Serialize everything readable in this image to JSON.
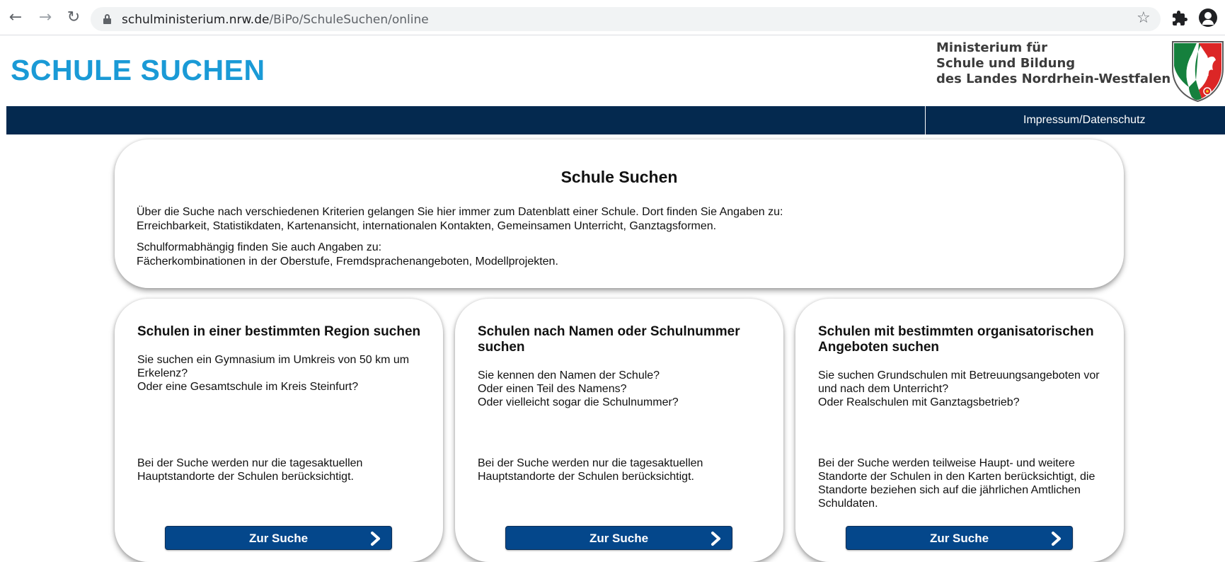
{
  "browser": {
    "url_domain": "schulministerium.nrw.de",
    "url_path": "/BiPo/SchuleSuchen/online",
    "icons": [
      "back-arrow-icon",
      "forward-arrow-icon",
      "reload-icon",
      "lock-icon",
      "star-icon",
      "extensions-icon",
      "profile-icon"
    ]
  },
  "header": {
    "site_title": "SCHULE SUCHEN",
    "ministry_line1": "Ministerium für",
    "ministry_line2": "Schule und Bildung",
    "ministry_line3": "des Landes Nordrhein-Westfalen",
    "logo_icon": "nrw-coat-of-arms-icon"
  },
  "navbar": {
    "link": "Impressum/Datenschutz"
  },
  "intro": {
    "title": "Schule Suchen",
    "p1_line1": "Über die Suche nach verschiedenen Kriterien gelangen Sie hier immer zum Datenblatt einer Schule. Dort finden Sie Angaben zu:",
    "p1_line2": "Erreichbarkeit, Statistikdaten, Kartenansicht, internationalen Kontakten, Gemeinsamen Unterricht, Ganztagsformen.",
    "p2_line1": "Schulformabhängig finden Sie auch Angaben zu:",
    "p2_line2": "Fächerkombinationen in der Oberstufe, Fremdsprachenangeboten, Modellprojekten."
  },
  "cards": [
    {
      "title": "Schulen in einer bestimmten Region suchen",
      "desc_line1": "Sie suchen ein Gymnasium im Umkreis von 50 km um",
      "desc_line2": "Erkelenz?",
      "desc_line3": "Oder eine Gesamtschule im Kreis Steinfurt?",
      "note_line1": "Bei der Suche werden nur die tagesaktuellen",
      "note_line2": "Hauptstandorte der Schulen berücksichtigt.",
      "button": "Zur Suche"
    },
    {
      "title": "Schulen nach Namen oder Schulnummer suchen",
      "desc_line1": "Sie kennen den Namen der Schule?",
      "desc_line2": "Oder einen Teil des Namens?",
      "desc_line3": "Oder vielleicht sogar die Schulnummer?",
      "note_line1": "Bei der Suche werden nur die tagesaktuellen",
      "note_line2": "Hauptstandorte der Schulen berücksichtigt.",
      "button": "Zur Suche"
    },
    {
      "title": "Schulen mit bestimmten organisatorischen Angeboten suchen",
      "desc_line1": "Sie suchen Grundschulen mit Betreuungsangeboten vor",
      "desc_line2": "und nach dem Unterricht?",
      "desc_line3": "Oder Realschulen mit Ganztagsbetrieb?",
      "note_line1": "Bei der Suche werden teilweise Haupt- und weitere",
      "note_line2": "Standorte der Schulen in den Karten berücksichtigt, die",
      "note_line3": "Standorte beziehen sich auf die jährlichen Amtlichen",
      "note_line4": "Schuldaten.",
      "button": "Zur Suche"
    }
  ],
  "colors": {
    "title_blue": "#1a9ad6",
    "navbar": "#04294f",
    "button": "#04478b"
  }
}
